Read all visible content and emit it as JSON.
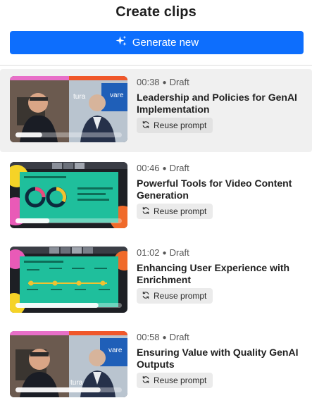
{
  "header": {
    "title": "Create clips"
  },
  "generate_button": {
    "label": "Generate new",
    "color": "#0d6efd"
  },
  "clips": [
    {
      "duration": "00:38",
      "status": "Draft",
      "title": "Leadership and Policies for GenAI Implementation",
      "reuse_label": "Reuse prompt",
      "thumbnail": "two-speakers-video",
      "progress": 0.25
    },
    {
      "duration": "00:46",
      "status": "Draft",
      "title": "Powerful Tools for Video Content Generation",
      "reuse_label": "Reuse prompt",
      "thumbnail": "slide-donut-charts",
      "progress": 0.32
    },
    {
      "duration": "01:02",
      "status": "Draft",
      "title": "Enhancing User Experience with Enrichment",
      "reuse_label": "Reuse prompt",
      "thumbnail": "slide-timeline",
      "progress": 0.78
    },
    {
      "duration": "00:58",
      "status": "Draft",
      "title": "Ensuring Value with Quality GenAI Outputs",
      "reuse_label": "Reuse prompt",
      "thumbnail": "two-speakers-video",
      "progress": 0.8
    }
  ]
}
